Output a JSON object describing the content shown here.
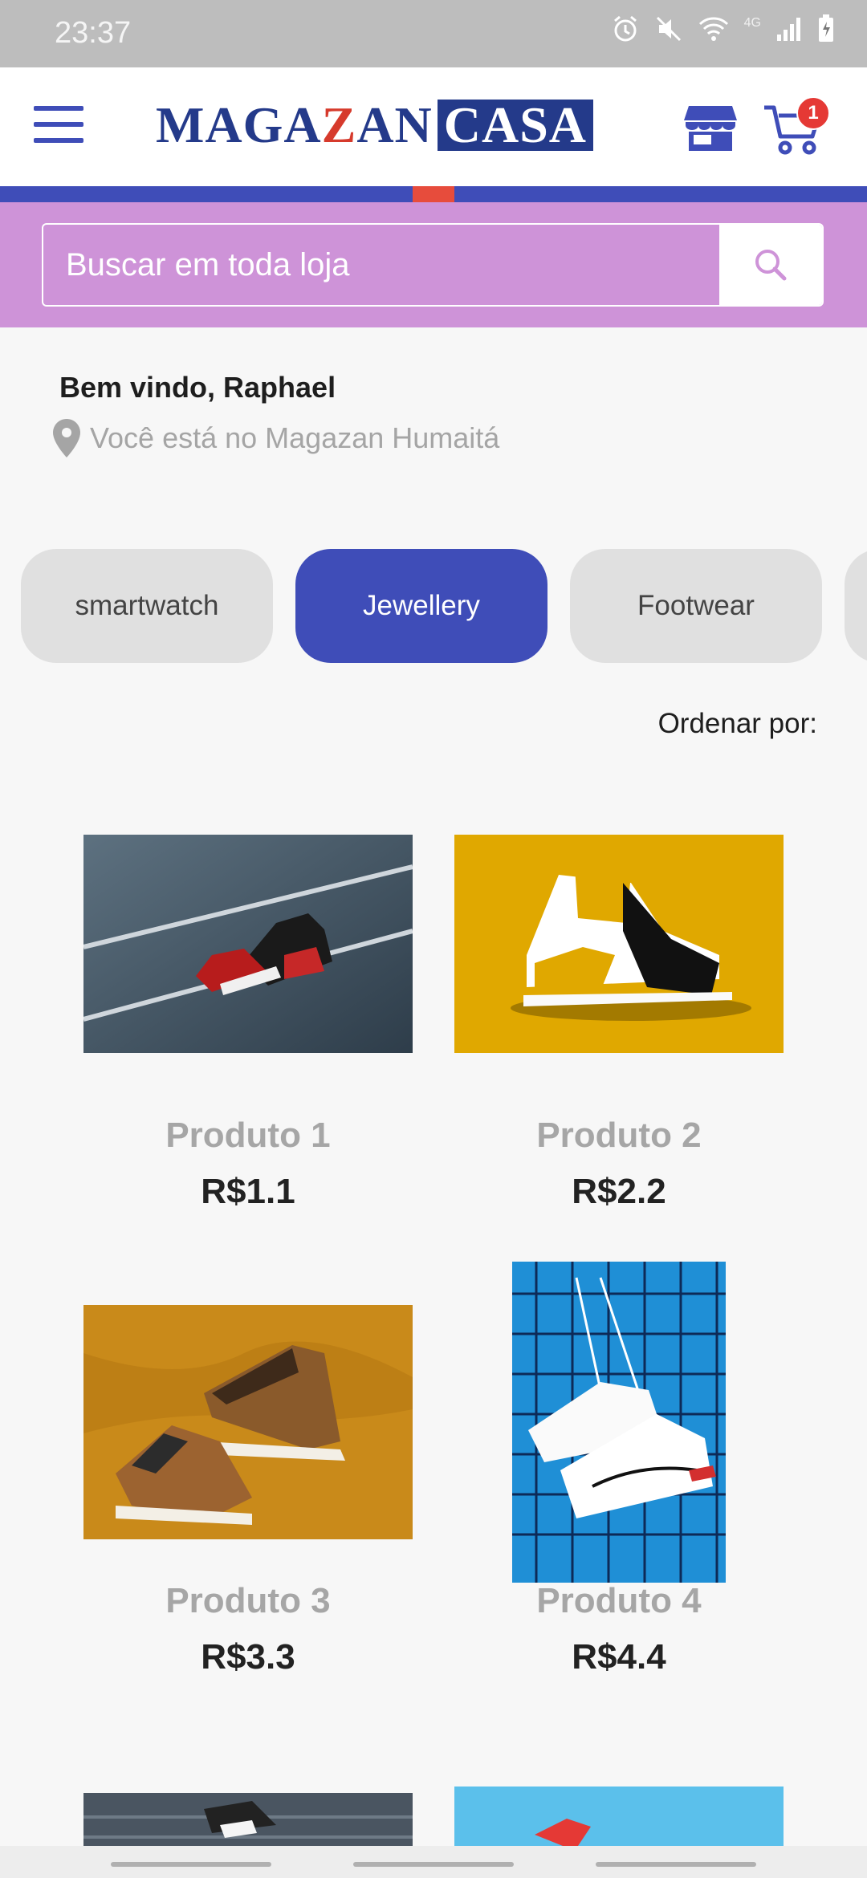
{
  "status_bar": {
    "time": "23:37",
    "network": "4G"
  },
  "header": {
    "logo": {
      "part1": "MAGA",
      "part2": "Z",
      "part3": "AN",
      "part4": "CASA"
    },
    "cart_count": "1"
  },
  "search": {
    "placeholder": "Buscar em toda loja"
  },
  "welcome": {
    "greeting": "Bem vindo, Raphael",
    "location": "Você está no Magazan Humaitá"
  },
  "categories": [
    {
      "label": "smartwatch",
      "active": false
    },
    {
      "label": "Jewellery",
      "active": true
    },
    {
      "label": "Footwear",
      "active": false
    }
  ],
  "sort": {
    "label": "Ordenar por:"
  },
  "products": [
    {
      "name": "Produto 1",
      "price": "R$1.1"
    },
    {
      "name": "Produto 2",
      "price": "R$2.2"
    },
    {
      "name": "Produto 3",
      "price": "R$3.3"
    },
    {
      "name": "Produto 4",
      "price": "R$4.4"
    }
  ],
  "colors": {
    "brand_blue": "#3f4db8",
    "accent_red": "#e53935",
    "search_band": "#ce93d8",
    "chip_inactive": "#e0e0e0"
  }
}
